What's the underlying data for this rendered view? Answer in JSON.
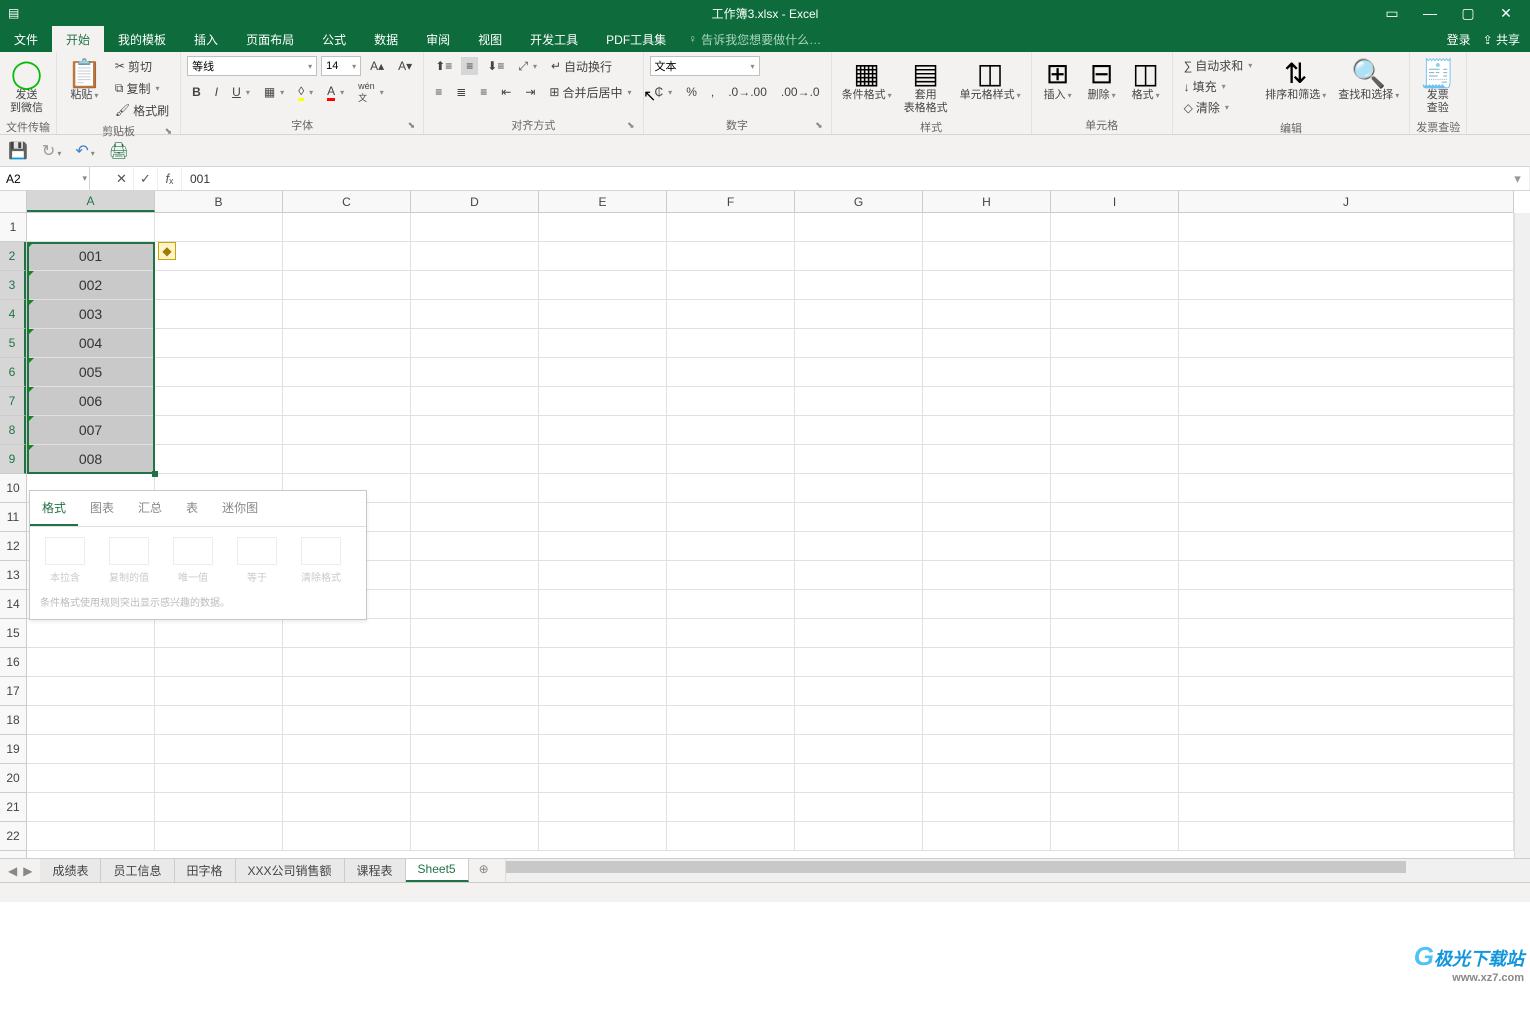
{
  "title": {
    "filename": "工作簿3.xlsx",
    "appname": "Excel"
  },
  "win": {
    "ribbonopts": "▭",
    "min": "—",
    "max": "▢",
    "close": "✕"
  },
  "menus": {
    "file": "文件",
    "home": "开始",
    "templates": "我的模板",
    "insert": "插入",
    "pagelayout": "页面布局",
    "formulas": "公式",
    "data": "数据",
    "review": "审阅",
    "view": "视图",
    "developer": "开发工具",
    "pdf": "PDF工具集",
    "tellme": "告诉我您想要做什么…",
    "login": "登录",
    "share": "共享"
  },
  "ribbon": {
    "wechat": {
      "label": "发送\n到微信",
      "group": "文件传输"
    },
    "clipboard": {
      "paste": "粘贴",
      "cut": "剪切",
      "copy": "复制",
      "painter": "格式刷",
      "group": "剪贴板"
    },
    "font": {
      "name_value": "等线",
      "size_value": "14",
      "group": "字体"
    },
    "align": {
      "wrap": "自动换行",
      "merge": "合并后居中",
      "group": "对齐方式"
    },
    "number": {
      "format_value": "文本",
      "group": "数字"
    },
    "styles": {
      "cond": "条件格式",
      "table": "套用\n表格格式",
      "cellstyle": "单元格样式",
      "group": "样式"
    },
    "cells": {
      "insert": "插入",
      "delete": "删除",
      "format": "格式",
      "group": "单元格"
    },
    "editing": {
      "sum": "自动求和",
      "fill": "填充",
      "clear": "清除",
      "sort": "排序和筛选",
      "find": "查找和选择",
      "group": "编辑"
    },
    "invoice": {
      "label": "发票\n查验",
      "group": "发票查验"
    }
  },
  "fbar": {
    "name": "A2",
    "formula": "001"
  },
  "columns": [
    "A",
    "B",
    "C",
    "D",
    "E",
    "F",
    "G",
    "H",
    "I",
    "J"
  ],
  "rows": [
    "1",
    "2",
    "3",
    "4",
    "5",
    "6",
    "7",
    "8",
    "9",
    "10",
    "11",
    "12",
    "13",
    "14",
    "15",
    "16",
    "17",
    "18",
    "19",
    "20",
    "21",
    "22"
  ],
  "cells_A": [
    "",
    "001",
    "002",
    "003",
    "004",
    "005",
    "006",
    "007",
    "008"
  ],
  "qpop": {
    "tabs": {
      "format": "格式",
      "chart": "图表",
      "total": "汇总",
      "table": "表",
      "spark": "迷你图"
    },
    "items": [
      "本拉含",
      "复制的值",
      "唯一值",
      "等于",
      "清除格式"
    ],
    "hint": "条件格式使用规则突出显示感兴趣的数据。"
  },
  "sheets": {
    "tabs": [
      "成绩表",
      "员工信息",
      "田字格",
      "XXX公司销售额",
      "课程表",
      "Sheet5"
    ],
    "active": "Sheet5"
  },
  "watermark": {
    "name": "极光下载站",
    "url": "www.xz7.com"
  }
}
